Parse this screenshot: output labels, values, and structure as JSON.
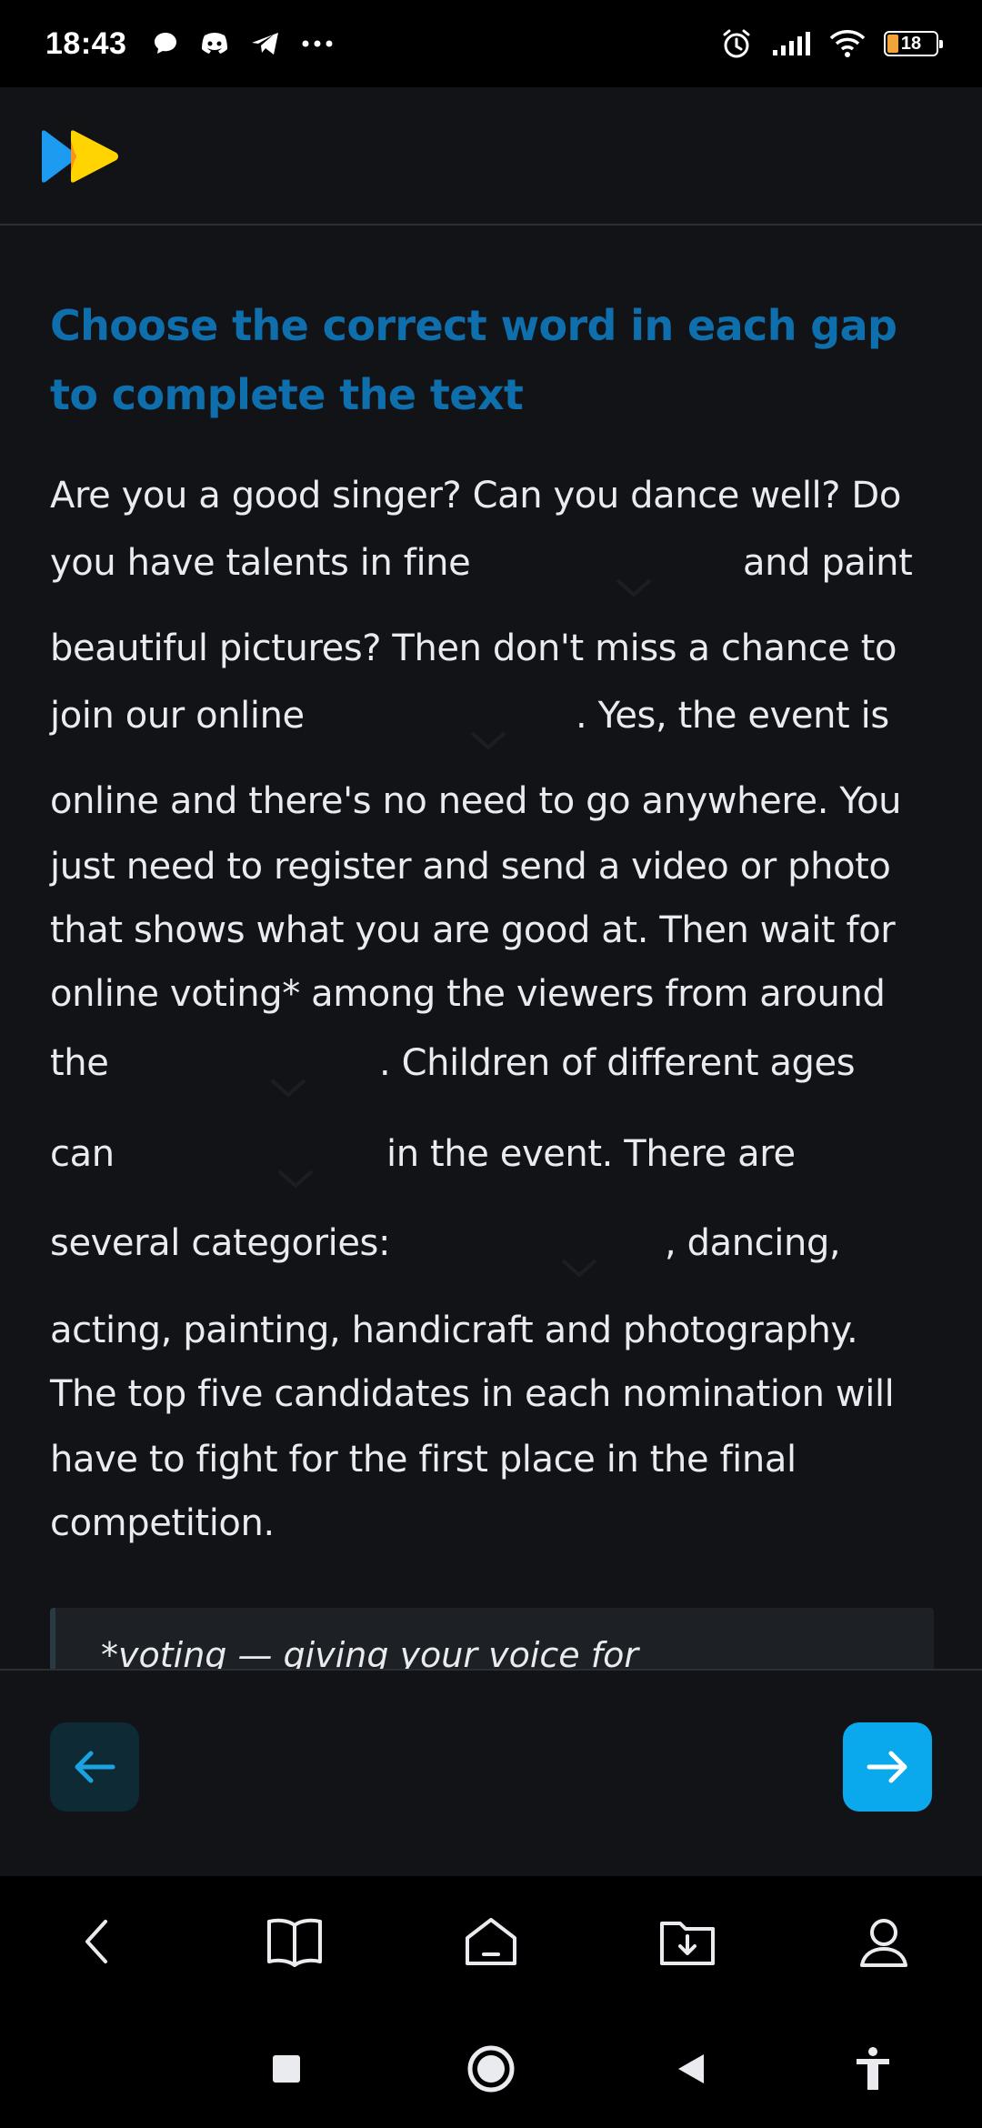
{
  "status": {
    "time": "18:43",
    "battery": "18",
    "icons_left": [
      "chat-bubble-icon",
      "discord-icon",
      "telegram-icon",
      "more-dots-icon"
    ],
    "icons_right": [
      "alarm-icon",
      "signal-icon",
      "wifi-icon",
      "battery-icon"
    ]
  },
  "colors": {
    "background": "#121316",
    "title": "#0f6fad",
    "accent": "#0aa8ec",
    "back_button_bg": "#0d2a35",
    "logo_blue": "#1d9bf0",
    "logo_yellow": "#ffd400"
  },
  "task": {
    "title_line1": "Choose the correct word in each gap",
    "title_line2": "to complete the text",
    "lines": {
      "l1": "Are you a good singer? Can you dance well? Do",
      "l2a": "you have talents in fine",
      "l2b": "and paint",
      "l3": "beautiful pictures? Then don't miss a chance to",
      "l4a": "join our online",
      "l4b": ". Yes, the event is",
      "l5": "online and there's no need to go anywhere. You",
      "l6": "just need to register and send a video or photo",
      "l7": "that shows what you are good at. Then wait for",
      "l8": "online voting* among the viewers from around",
      "l9a": "the",
      "l9b": ". Children of different ages",
      "l10a": "can",
      "l10b": "in the event. There are",
      "l11a": "several categories:",
      "l11b": ", dancing,",
      "l12": "acting, painting, handicraft and photography.",
      "l13": "The top five candidates in each nomination will",
      "l14": "have to fight for the first place in the final",
      "l15": "competition."
    },
    "gaps": [
      {
        "id": 1,
        "selected": ""
      },
      {
        "id": 2,
        "selected": ""
      },
      {
        "id": 3,
        "selected": ""
      },
      {
        "id": 4,
        "selected": ""
      },
      {
        "id": 5,
        "selected": ""
      }
    ],
    "note": "*voting — giving your voice for"
  },
  "bottom_nav": {
    "items": [
      "back-chevron-icon",
      "book-icon",
      "home-icon",
      "download-folder-icon",
      "profile-icon"
    ]
  },
  "system_nav": {
    "items": [
      "recents-square-icon",
      "home-circle-icon",
      "back-triangle-icon",
      "accessibility-icon"
    ]
  }
}
